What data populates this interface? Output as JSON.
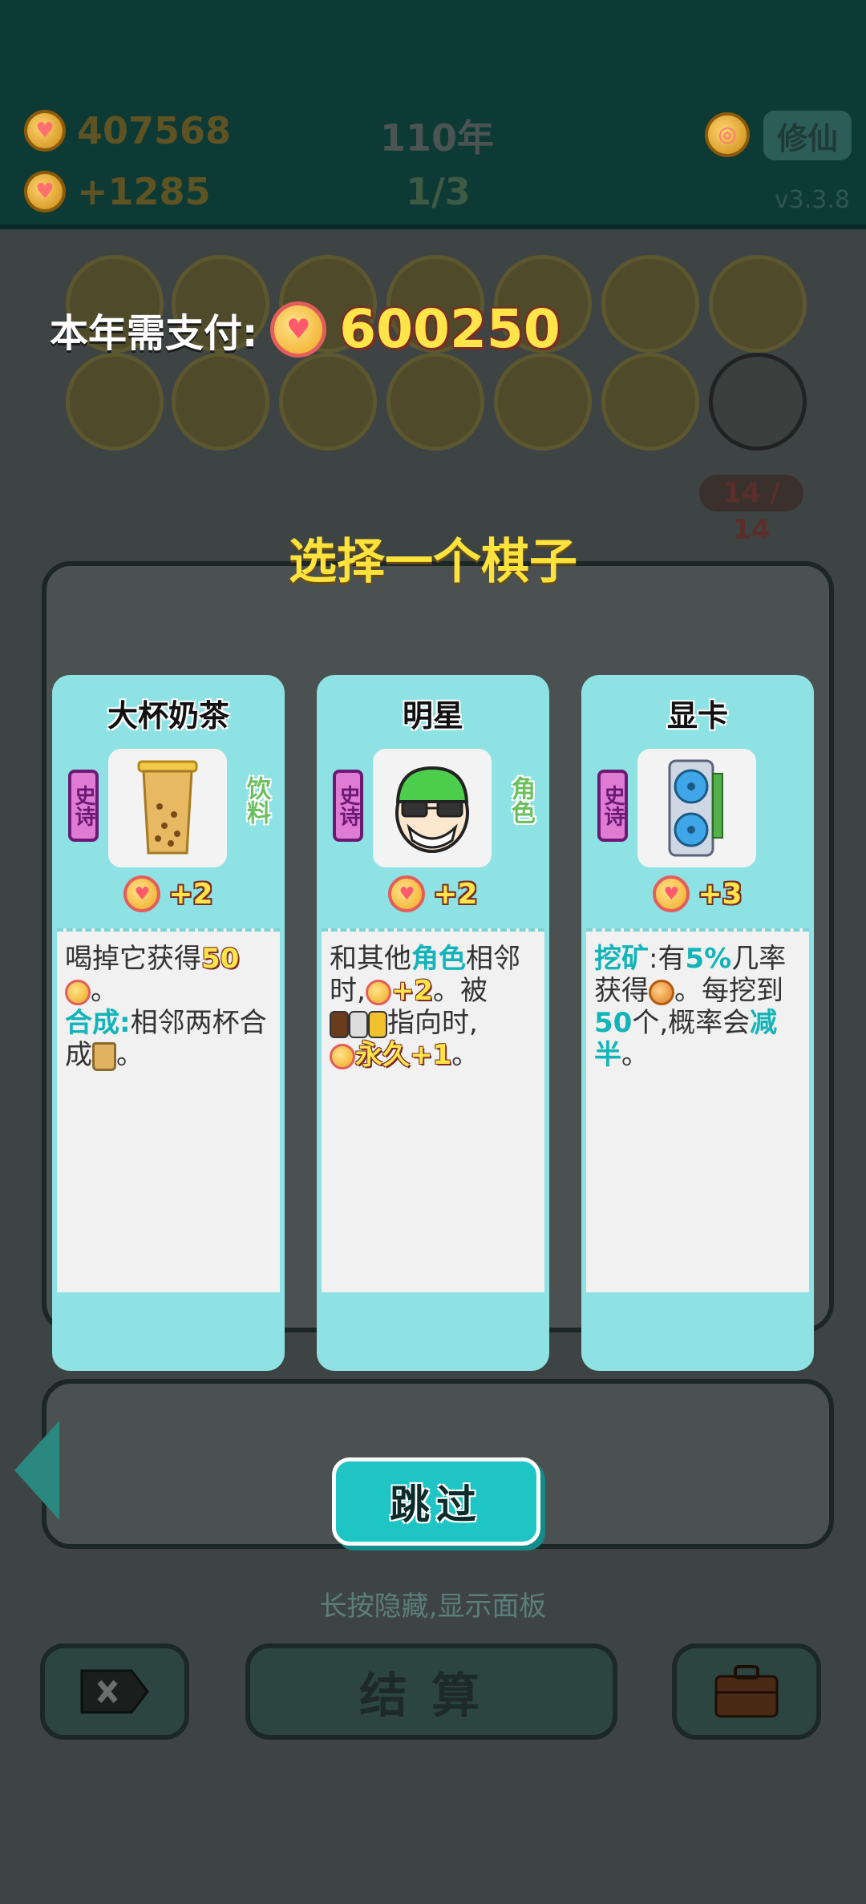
{
  "hud": {
    "coins": "407568",
    "income": "+1285",
    "year": "110年",
    "round": "1/3",
    "cultivate_label": "修仙",
    "version": "v3.3.8"
  },
  "board": {
    "pager": "14 / 14"
  },
  "payment": {
    "label": "本年需支付:",
    "amount": "600250"
  },
  "choice": {
    "title": "选择一个棋子",
    "cards": [
      {
        "name": "大杯奶茶",
        "rarity": "史诗",
        "category": "饮料",
        "bonus": "+2",
        "desc": {
          "p1": "喝掉它获得",
          "n1": "50",
          "p2": "。",
          "k1": "合成:",
          "p3": "相邻两杯合成",
          "p4": "。"
        }
      },
      {
        "name": "明星",
        "rarity": "史诗",
        "category": "角色",
        "bonus": "+2",
        "desc": {
          "p1": "和其他",
          "k1": "角色",
          "p2": "相邻时,",
          "n1": "+2",
          "p3": "。被",
          "p4": "指向时,",
          "n2": "永久+1",
          "p5": "。"
        }
      },
      {
        "name": "显卡",
        "rarity": "史诗",
        "category": "",
        "bonus": "+3",
        "desc": {
          "k1": "挖矿",
          "p1": ":有",
          "k2": "5%",
          "p2": "几率获得",
          "p3": "。每挖到",
          "k3": "50",
          "p4": "个,概率会",
          "k4": "减半",
          "p5": "。"
        }
      }
    ]
  },
  "buttons": {
    "skip": "跳过",
    "settle": "结算"
  },
  "hint": "长按隐藏,显示面板"
}
